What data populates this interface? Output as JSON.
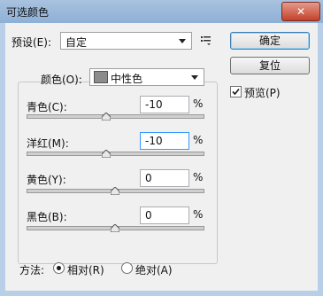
{
  "dialog": {
    "title": "可选颜色",
    "close_glyph": "✕"
  },
  "preset": {
    "label": "预设(E):",
    "value": "自定",
    "menu_icon": "preset-menu-icon"
  },
  "buttons": {
    "ok": "确定",
    "reset": "复位",
    "preview_label": "预览(P)",
    "preview_checked": true
  },
  "colors": {
    "label": "颜色(O):",
    "value": "中性色",
    "swatch_color": "#8c8c8c"
  },
  "sliders": [
    {
      "label": "青色(C):",
      "value": "-10",
      "unit": "%",
      "level": -10,
      "active": false
    },
    {
      "label": "洋红(M):",
      "value": "-10",
      "unit": "%",
      "level": -10,
      "active": true
    },
    {
      "label": "黄色(Y):",
      "value": "0",
      "unit": "%",
      "level": 0,
      "active": false
    },
    {
      "label": "黑色(B):",
      "value": "0",
      "unit": "%",
      "level": 0,
      "active": false
    }
  ],
  "method": {
    "label": "方法:",
    "options": [
      {
        "label": "相对(R)",
        "selected": true
      },
      {
        "label": "绝对(A)",
        "selected": false
      }
    ]
  }
}
